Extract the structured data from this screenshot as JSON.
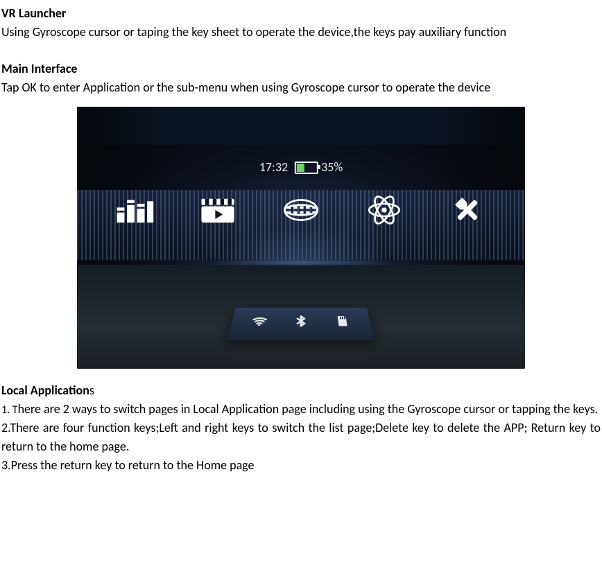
{
  "sections": {
    "vr_launcher_title": "VR Launcher",
    "vr_launcher_body": "Using Gyroscope cursor or taping the key sheet to operate the device,the keys pay auxiliary function",
    "main_interface_title": "Main Interface",
    "main_interface_body": "Tap OK to enter Application or the sub-menu when using Gyroscope cursor to operate the device",
    "local_apps_title_part1": "Local Application",
    "local_apps_title_part2": "s",
    "local_apps_item1_prefix": "1. T",
    "local_apps_item1_rest": "here are 2 ways to switch pages in Local Application page including using the Gyroscope cursor or tapping the keys.",
    "local_apps_item2": "2.There are four function keys;Left and right keys to switch the list page;Delete key to delete the APP; Return key to return to the home page.",
    "local_apps_item3": "3.Press the return key to return to the Home page"
  },
  "screenshot": {
    "time": "17:32",
    "battery_percent": "35%",
    "main_icons": [
      "apps-icon",
      "video-icon",
      "panorama-icon",
      "atom-icon",
      "tools-icon"
    ],
    "tray_icons": [
      "wifi-icon",
      "bluetooth-icon",
      "sdcard-icon"
    ]
  }
}
